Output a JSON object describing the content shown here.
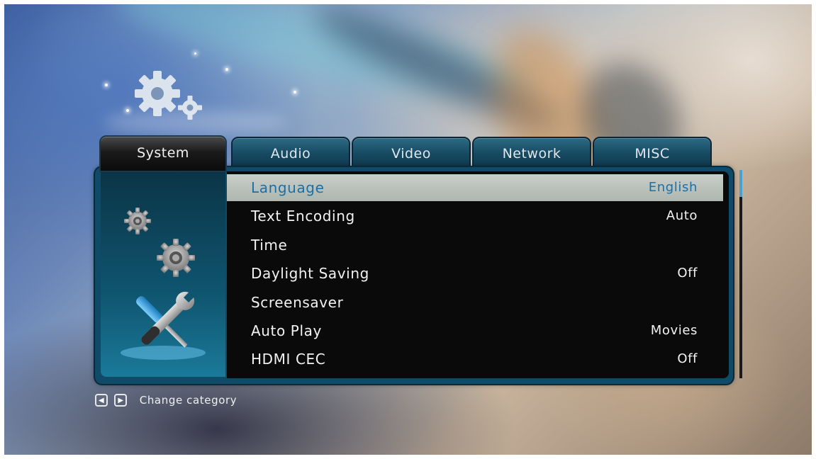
{
  "tabs": [
    {
      "label": "System",
      "active": true
    },
    {
      "label": "Audio",
      "active": false
    },
    {
      "label": "Video",
      "active": false
    },
    {
      "label": "Network",
      "active": false
    },
    {
      "label": "MISC",
      "active": false
    }
  ],
  "settings": [
    {
      "label": "Language",
      "value": "English",
      "selected": true
    },
    {
      "label": "Text Encoding",
      "value": "Auto"
    },
    {
      "label": "Time",
      "value": ""
    },
    {
      "label": "Daylight Saving",
      "value": "Off"
    },
    {
      "label": "Screensaver",
      "value": ""
    },
    {
      "label": "Auto Play",
      "value": "Movies"
    },
    {
      "label": "HDMI CEC",
      "value": "Off"
    }
  ],
  "footer": {
    "left_key_icon": "arrow-left-icon",
    "right_key_icon": "arrow-right-icon",
    "hint": "Change category"
  },
  "colors": {
    "accent": "#1a70a8",
    "selected_row": "#bcc3bd",
    "tab_inactive": "#174a62"
  }
}
